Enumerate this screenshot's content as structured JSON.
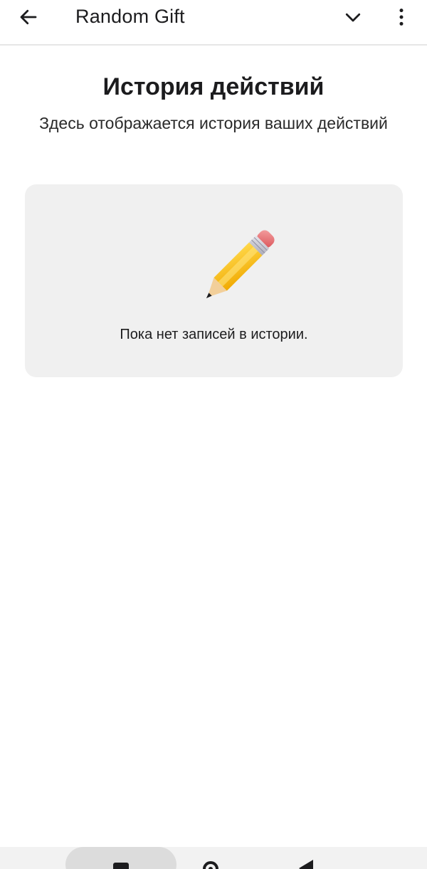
{
  "appbar": {
    "title": "Random Gift",
    "icons": {
      "back": "arrow-left-icon",
      "expand": "chevron-down-icon",
      "menu": "more-vertical-icon"
    }
  },
  "header": {
    "title": "История действий",
    "subtitle": "Здесь отображается история ваших действий"
  },
  "empty_state": {
    "icon": "pencil-icon",
    "message": "Пока нет записей в истории."
  },
  "system_nav": {
    "icons": [
      "recents-icon",
      "home-icon",
      "back-triangle-icon"
    ]
  },
  "colors": {
    "card_background": "#f0f0f0",
    "text_primary": "#1c1c1e",
    "divider": "#e6e6e6"
  }
}
